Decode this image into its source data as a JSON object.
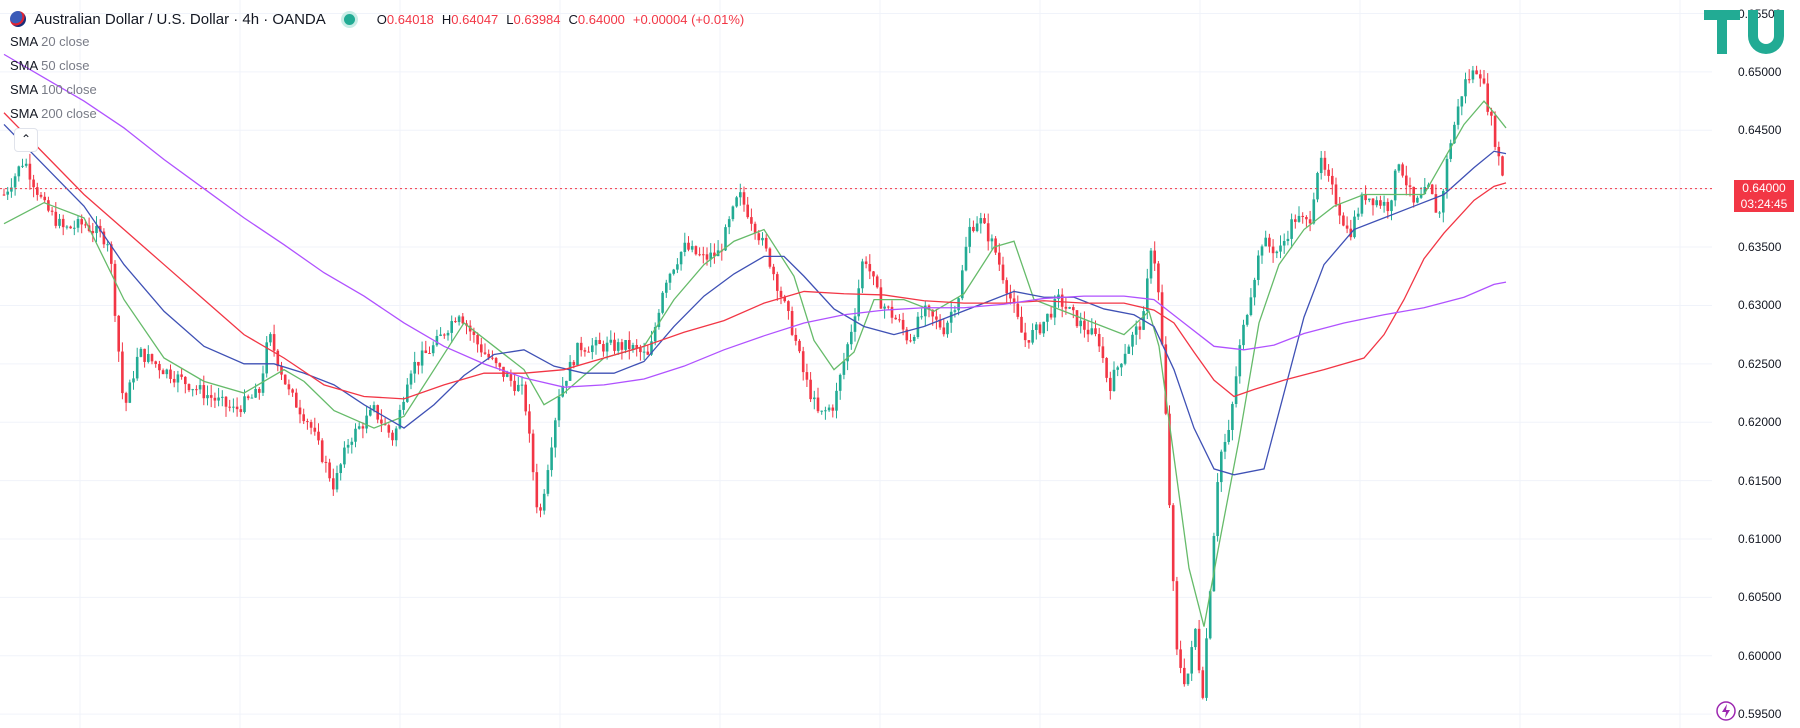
{
  "header": {
    "symbol": "Australian Dollar / U.S. Dollar · 4h · OANDA",
    "o_label": "O",
    "o_val": "0.64018",
    "h_label": "H",
    "h_val": "0.64047",
    "l_label": "L",
    "l_val": "0.63984",
    "c_label": "C",
    "c_val": "0.64000",
    "change": "+0.00004 (+0.01%)"
  },
  "indicators": [
    {
      "name": "SMA",
      "param": "20 close",
      "color": "#66bb6a"
    },
    {
      "name": "SMA",
      "param": "50 close",
      "color": "#3f51b5"
    },
    {
      "name": "SMA",
      "param": "100 close",
      "color": "#f23645"
    },
    {
      "name": "SMA",
      "param": "200 close",
      "color": "#b052ff"
    }
  ],
  "collapse_icon": "chevron-up-icon",
  "price_label": {
    "price": "0.64000",
    "countdown": "03:24:45"
  },
  "colors": {
    "up": "#22ab94",
    "down": "#f23645",
    "grid": "#f0f3fa",
    "brand": "#22ab94"
  },
  "chart_data": {
    "type": "candlestick",
    "timeframe": "4h",
    "ylim": [
      0.5945,
      0.6553
    ],
    "y_ticks": [
      "0.65500",
      "0.65000",
      "0.64500",
      "0.64000",
      "0.63500",
      "0.63000",
      "0.62500",
      "0.62000",
      "0.61500",
      "0.61000",
      "0.60500",
      "0.60000",
      "0.59500"
    ],
    "last_price": 0.64,
    "close_path": [
      [
        0,
        0.6395
      ],
      [
        20,
        0.6425
      ],
      [
        40,
        0.6385
      ],
      [
        60,
        0.6365
      ],
      [
        80,
        0.637
      ],
      [
        105,
        0.6355
      ],
      [
        120,
        0.621
      ],
      [
        135,
        0.626
      ],
      [
        160,
        0.6245
      ],
      [
        200,
        0.6225
      ],
      [
        230,
        0.621
      ],
      [
        255,
        0.6225
      ],
      [
        265,
        0.6275
      ],
      [
        285,
        0.6225
      ],
      [
        305,
        0.62
      ],
      [
        330,
        0.6145
      ],
      [
        345,
        0.6185
      ],
      [
        370,
        0.621
      ],
      [
        390,
        0.6185
      ],
      [
        405,
        0.6245
      ],
      [
        430,
        0.6265
      ],
      [
        455,
        0.6295
      ],
      [
        475,
        0.6265
      ],
      [
        495,
        0.6245
      ],
      [
        520,
        0.6225
      ],
      [
        535,
        0.6115
      ],
      [
        555,
        0.6225
      ],
      [
        575,
        0.6265
      ],
      [
        600,
        0.6265
      ],
      [
        625,
        0.6265
      ],
      [
        645,
        0.6255
      ],
      [
        660,
        0.632
      ],
      [
        680,
        0.635
      ],
      [
        700,
        0.634
      ],
      [
        715,
        0.6345
      ],
      [
        735,
        0.6395
      ],
      [
        750,
        0.637
      ],
      [
        765,
        0.634
      ],
      [
        790,
        0.6275
      ],
      [
        800,
        0.624
      ],
      [
        815,
        0.6205
      ],
      [
        830,
        0.6215
      ],
      [
        850,
        0.629
      ],
      [
        860,
        0.6345
      ],
      [
        875,
        0.6305
      ],
      [
        895,
        0.6285
      ],
      [
        905,
        0.627
      ],
      [
        920,
        0.6295
      ],
      [
        940,
        0.628
      ],
      [
        955,
        0.631
      ],
      [
        965,
        0.6365
      ],
      [
        975,
        0.6375
      ],
      [
        990,
        0.635
      ],
      [
        1005,
        0.631
      ],
      [
        1020,
        0.627
      ],
      [
        1035,
        0.628
      ],
      [
        1055,
        0.6305
      ],
      [
        1075,
        0.6285
      ],
      [
        1095,
        0.627
      ],
      [
        1105,
        0.623
      ],
      [
        1120,
        0.626
      ],
      [
        1140,
        0.629
      ],
      [
        1148,
        0.636
      ],
      [
        1155,
        0.6305
      ],
      [
        1160,
        0.624
      ],
      [
        1165,
        0.614
      ],
      [
        1172,
        0.6005
      ],
      [
        1182,
        0.5975
      ],
      [
        1192,
        0.6025
      ],
      [
        1198,
        0.596
      ],
      [
        1205,
        0.6045
      ],
      [
        1215,
        0.617
      ],
      [
        1225,
        0.619
      ],
      [
        1235,
        0.626
      ],
      [
        1245,
        0.6305
      ],
      [
        1258,
        0.6355
      ],
      [
        1275,
        0.6345
      ],
      [
        1290,
        0.6375
      ],
      [
        1305,
        0.637
      ],
      [
        1315,
        0.6425
      ],
      [
        1330,
        0.6395
      ],
      [
        1345,
        0.636
      ],
      [
        1360,
        0.6395
      ],
      [
        1385,
        0.6385
      ],
      [
        1395,
        0.6425
      ],
      [
        1410,
        0.6385
      ],
      [
        1425,
        0.64
      ],
      [
        1435,
        0.6375
      ],
      [
        1445,
        0.6435
      ],
      [
        1460,
        0.649
      ],
      [
        1475,
        0.6505
      ],
      [
        1488,
        0.6455
      ],
      [
        1495,
        0.6425
      ],
      [
        1502,
        0.6402
      ]
    ],
    "sma_20": [
      [
        0,
        0.637
      ],
      [
        40,
        0.6388
      ],
      [
        80,
        0.6375
      ],
      [
        120,
        0.6305
      ],
      [
        160,
        0.6255
      ],
      [
        200,
        0.6235
      ],
      [
        240,
        0.6225
      ],
      [
        280,
        0.6245
      ],
      [
        300,
        0.6235
      ],
      [
        330,
        0.621
      ],
      [
        370,
        0.6195
      ],
      [
        400,
        0.6205
      ],
      [
        430,
        0.6245
      ],
      [
        460,
        0.6285
      ],
      [
        490,
        0.6265
      ],
      [
        520,
        0.6245
      ],
      [
        540,
        0.6215
      ],
      [
        560,
        0.6225
      ],
      [
        600,
        0.6255
      ],
      [
        640,
        0.6265
      ],
      [
        670,
        0.6305
      ],
      [
        700,
        0.6335
      ],
      [
        730,
        0.6355
      ],
      [
        760,
        0.6365
      ],
      [
        790,
        0.6325
      ],
      [
        810,
        0.627
      ],
      [
        830,
        0.6245
      ],
      [
        850,
        0.626
      ],
      [
        870,
        0.6305
      ],
      [
        900,
        0.6305
      ],
      [
        930,
        0.6295
      ],
      [
        960,
        0.631
      ],
      [
        990,
        0.635
      ],
      [
        1010,
        0.6355
      ],
      [
        1030,
        0.6305
      ],
      [
        1060,
        0.6295
      ],
      [
        1090,
        0.6285
      ],
      [
        1120,
        0.6275
      ],
      [
        1145,
        0.6295
      ],
      [
        1155,
        0.6265
      ],
      [
        1170,
        0.617
      ],
      [
        1185,
        0.6075
      ],
      [
        1200,
        0.6025
      ],
      [
        1215,
        0.6095
      ],
      [
        1235,
        0.6185
      ],
      [
        1255,
        0.6285
      ],
      [
        1275,
        0.6335
      ],
      [
        1300,
        0.6365
      ],
      [
        1330,
        0.6385
      ],
      [
        1360,
        0.6395
      ],
      [
        1390,
        0.6395
      ],
      [
        1420,
        0.6395
      ],
      [
        1440,
        0.6425
      ],
      [
        1460,
        0.6455
      ],
      [
        1480,
        0.6475
      ],
      [
        1490,
        0.6465
      ],
      [
        1502,
        0.6452
      ]
    ],
    "sma_50": [
      [
        0,
        0.6455
      ],
      [
        40,
        0.642
      ],
      [
        80,
        0.6385
      ],
      [
        120,
        0.6335
      ],
      [
        160,
        0.6295
      ],
      [
        200,
        0.6265
      ],
      [
        240,
        0.625
      ],
      [
        270,
        0.625
      ],
      [
        300,
        0.6242
      ],
      [
        330,
        0.6232
      ],
      [
        360,
        0.6215
      ],
      [
        400,
        0.6195
      ],
      [
        430,
        0.6215
      ],
      [
        460,
        0.624
      ],
      [
        490,
        0.6258
      ],
      [
        520,
        0.6262
      ],
      [
        550,
        0.6248
      ],
      [
        580,
        0.6242
      ],
      [
        610,
        0.6242
      ],
      [
        640,
        0.6252
      ],
      [
        670,
        0.6282
      ],
      [
        700,
        0.6308
      ],
      [
        730,
        0.6327
      ],
      [
        760,
        0.6342
      ],
      [
        780,
        0.6342
      ],
      [
        800,
        0.6325
      ],
      [
        830,
        0.6297
      ],
      [
        860,
        0.6282
      ],
      [
        890,
        0.6275
      ],
      [
        920,
        0.6282
      ],
      [
        950,
        0.6292
      ],
      [
        980,
        0.6302
      ],
      [
        1010,
        0.6312
      ],
      [
        1040,
        0.6307
      ],
      [
        1070,
        0.6307
      ],
      [
        1100,
        0.6297
      ],
      [
        1130,
        0.6292
      ],
      [
        1150,
        0.6282
      ],
      [
        1170,
        0.6245
      ],
      [
        1190,
        0.6195
      ],
      [
        1210,
        0.616
      ],
      [
        1230,
        0.6155
      ],
      [
        1260,
        0.616
      ],
      [
        1280,
        0.6225
      ],
      [
        1300,
        0.629
      ],
      [
        1320,
        0.6335
      ],
      [
        1350,
        0.6365
      ],
      [
        1380,
        0.6375
      ],
      [
        1410,
        0.6385
      ],
      [
        1440,
        0.6395
      ],
      [
        1470,
        0.6418
      ],
      [
        1490,
        0.6432
      ],
      [
        1502,
        0.643
      ]
    ],
    "sma_100": [
      [
        0,
        0.6465
      ],
      [
        40,
        0.643
      ],
      [
        80,
        0.6395
      ],
      [
        120,
        0.6365
      ],
      [
        160,
        0.6335
      ],
      [
        200,
        0.6305
      ],
      [
        240,
        0.6275
      ],
      [
        280,
        0.6255
      ],
      [
        320,
        0.6232
      ],
      [
        360,
        0.6222
      ],
      [
        400,
        0.622
      ],
      [
        440,
        0.6232
      ],
      [
        480,
        0.6242
      ],
      [
        520,
        0.6242
      ],
      [
        560,
        0.6245
      ],
      [
        600,
        0.6255
      ],
      [
        640,
        0.6265
      ],
      [
        680,
        0.6277
      ],
      [
        720,
        0.6287
      ],
      [
        760,
        0.6302
      ],
      [
        800,
        0.6312
      ],
      [
        840,
        0.631
      ],
      [
        880,
        0.6309
      ],
      [
        920,
        0.6304
      ],
      [
        960,
        0.6302
      ],
      [
        1000,
        0.6302
      ],
      [
        1040,
        0.6304
      ],
      [
        1080,
        0.6302
      ],
      [
        1120,
        0.6302
      ],
      [
        1150,
        0.6296
      ],
      [
        1170,
        0.6285
      ],
      [
        1190,
        0.626
      ],
      [
        1210,
        0.6236
      ],
      [
        1230,
        0.6222
      ],
      [
        1250,
        0.6228
      ],
      [
        1280,
        0.6236
      ],
      [
        1320,
        0.6245
      ],
      [
        1360,
        0.6255
      ],
      [
        1380,
        0.6275
      ],
      [
        1400,
        0.6305
      ],
      [
        1420,
        0.634
      ],
      [
        1440,
        0.6362
      ],
      [
        1470,
        0.639
      ],
      [
        1490,
        0.6402
      ],
      [
        1502,
        0.6405
      ]
    ],
    "sma_200": [
      [
        0,
        0.6515
      ],
      [
        40,
        0.6495
      ],
      [
        80,
        0.6475
      ],
      [
        120,
        0.6452
      ],
      [
        160,
        0.6425
      ],
      [
        200,
        0.64
      ],
      [
        240,
        0.6375
      ],
      [
        280,
        0.6352
      ],
      [
        320,
        0.6328
      ],
      [
        360,
        0.6308
      ],
      [
        400,
        0.6285
      ],
      [
        440,
        0.6265
      ],
      [
        480,
        0.625
      ],
      [
        520,
        0.6238
      ],
      [
        560,
        0.623
      ],
      [
        600,
        0.6232
      ],
      [
        640,
        0.6237
      ],
      [
        680,
        0.6248
      ],
      [
        720,
        0.6262
      ],
      [
        760,
        0.6274
      ],
      [
        800,
        0.6285
      ],
      [
        840,
        0.6292
      ],
      [
        880,
        0.6296
      ],
      [
        920,
        0.6298
      ],
      [
        960,
        0.6298
      ],
      [
        1000,
        0.6301
      ],
      [
        1040,
        0.6306
      ],
      [
        1080,
        0.6308
      ],
      [
        1120,
        0.6308
      ],
      [
        1150,
        0.6305
      ],
      [
        1180,
        0.6285
      ],
      [
        1210,
        0.6265
      ],
      [
        1240,
        0.6262
      ],
      [
        1270,
        0.6266
      ],
      [
        1300,
        0.6276
      ],
      [
        1340,
        0.6285
      ],
      [
        1380,
        0.6292
      ],
      [
        1420,
        0.6298
      ],
      [
        1460,
        0.6307
      ],
      [
        1490,
        0.6318
      ],
      [
        1502,
        0.632
      ]
    ]
  }
}
